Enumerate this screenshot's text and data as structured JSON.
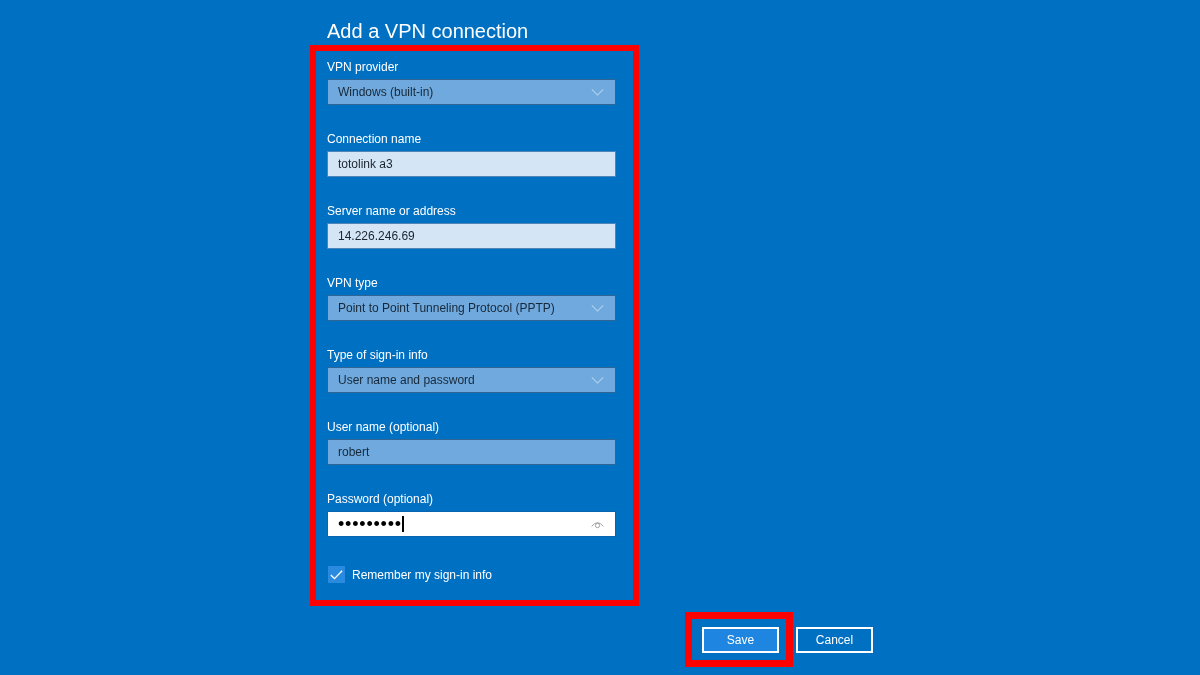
{
  "title": "Add a VPN connection",
  "form": {
    "annotated": true,
    "fields": [
      {
        "label": "VPN provider",
        "kind": "dropdown",
        "value": "Windows (built-in)"
      },
      {
        "label": "Connection name",
        "kind": "text",
        "value": "totolink a3",
        "highlighted": false
      },
      {
        "label": "Server name or address",
        "kind": "text",
        "value": "14.226.246.69",
        "highlighted": false
      },
      {
        "label": "VPN type",
        "kind": "dropdown",
        "value": "Point to Point Tunneling Protocol (PPTP)"
      },
      {
        "label": "Type of sign-in info",
        "kind": "dropdown",
        "value": "User name and password"
      },
      {
        "label": "User name (optional)",
        "kind": "text",
        "value": "robert",
        "highlighted": true
      },
      {
        "label": "Password (optional)",
        "kind": "password",
        "value": "•••••••••",
        "focused": true
      }
    ],
    "remember": {
      "label": "Remember my sign-in info",
      "checked": true
    }
  },
  "buttons": [
    {
      "label": "Save",
      "primary": true,
      "annotated": true
    },
    {
      "label": "Cancel",
      "primary": false,
      "annotated": false
    }
  ]
}
